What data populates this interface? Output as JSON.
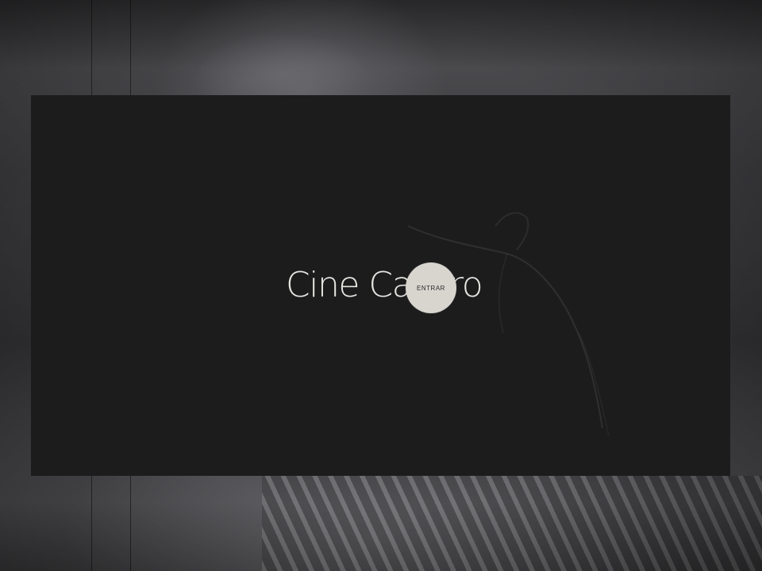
{
  "splash": {
    "title": "Cine Casero",
    "enter_label": "ENTRAR"
  },
  "colors": {
    "splash_background": "#1c1c1d",
    "title_text": "#e6e4e0",
    "enter_button": "#d8d5cf"
  }
}
